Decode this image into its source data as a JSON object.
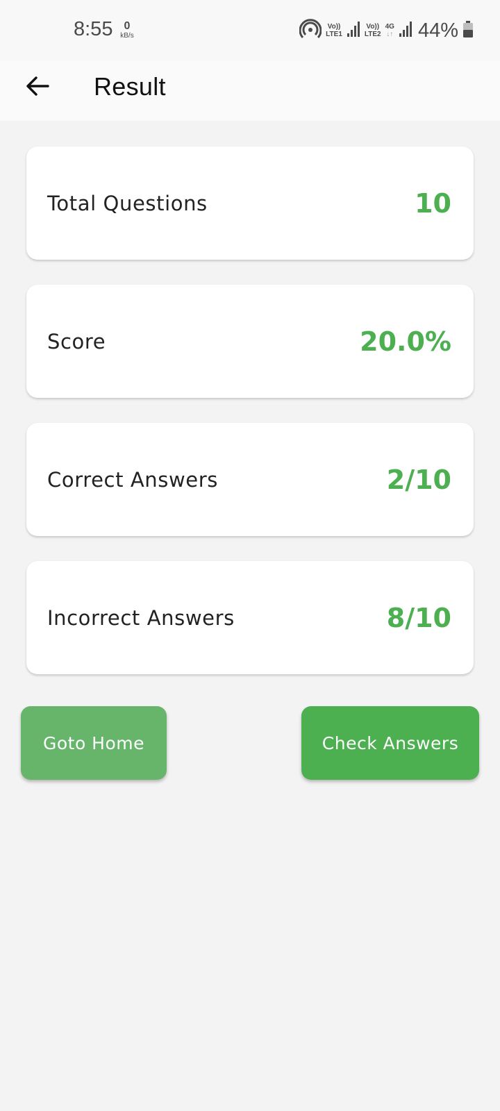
{
  "status_bar": {
    "time": "8:55",
    "speed_value": "0",
    "speed_unit": "kB/s",
    "sim1_top": "Vo))",
    "sim1_bottom": "LTE1",
    "sim2_top": "Vo))",
    "sim2_bottom": "LTE2",
    "network_type": "4G",
    "battery_percent": "44%"
  },
  "app_bar": {
    "title": "Result"
  },
  "cards": [
    {
      "label": "Total Questions",
      "value": "10"
    },
    {
      "label": "Score",
      "value": "20.0%"
    },
    {
      "label": "Correct Answers",
      "value": "2/10"
    },
    {
      "label": "Incorrect Answers",
      "value": "8/10"
    }
  ],
  "buttons": {
    "home_label": "Goto Home",
    "check_label": "Check Answers"
  },
  "colors": {
    "accent": "#4caf50",
    "home_button": "#66b56a",
    "background": "#f3f3f3"
  }
}
